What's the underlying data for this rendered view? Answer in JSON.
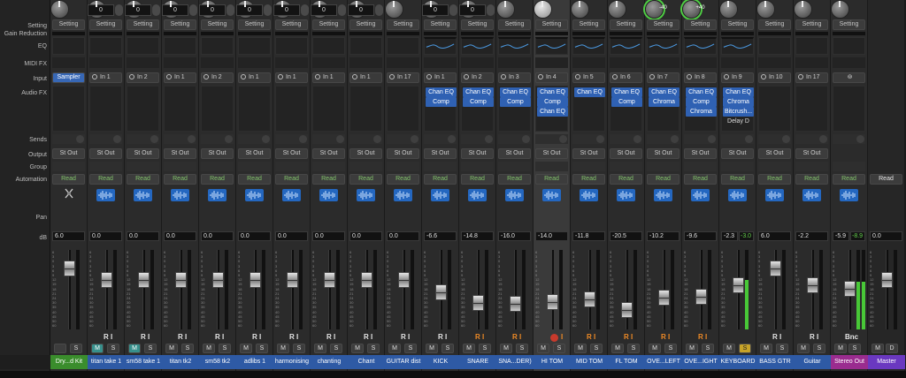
{
  "row_labels": [
    "Setting",
    "Gain Reduction",
    "EQ",
    "MIDI FX",
    "Input",
    "Audio FX",
    "Sends",
    "Output",
    "Group",
    "Automation",
    "Pan",
    "dB"
  ],
  "colors": {
    "drum": "#3a8d2c",
    "blue": "#2e5aa5",
    "pink": "#9a2c8f",
    "purple": "#6a38c0",
    "meter_green": "#48c837",
    "fx_blue": "#2f61b3"
  },
  "strips": [
    {
      "name": "Dry...d Kit",
      "color": "#3a8d2c",
      "input": "Sampler",
      "input_kind": "instrument",
      "output": "St Out",
      "automation": "Read",
      "db": "6.0",
      "fader": 0.85,
      "fx": [],
      "mute": false,
      "solo": false,
      "ri": "",
      "setting": "Setting",
      "icon": "drummer-icon"
    },
    {
      "name": "titan take 1",
      "color": "#2e5aa5",
      "digit": "0",
      "input": "In 1",
      "output": "St Out",
      "automation": "Read",
      "db": "0.0",
      "fader": 0.68,
      "fx": [],
      "mute": true,
      "solo": false,
      "ri": "R I",
      "setting": "Setting"
    },
    {
      "name": "sm58 take 1",
      "color": "#2e5aa5",
      "digit": "0",
      "input": "In 2",
      "output": "St Out",
      "automation": "Read",
      "db": "0.0",
      "fader": 0.68,
      "fx": [],
      "mute": true,
      "solo": false,
      "ri": "R I",
      "setting": "Setting"
    },
    {
      "name": "titan tk2",
      "color": "#2e5aa5",
      "digit": "0",
      "input": "In 1",
      "output": "St Out",
      "automation": "Read",
      "db": "0.0",
      "fader": 0.68,
      "fx": [],
      "mute": false,
      "solo": false,
      "ri": "R I",
      "setting": "Setting"
    },
    {
      "name": "sm58 tk2",
      "color": "#2e5aa5",
      "digit": "0",
      "input": "In 2",
      "output": "St Out",
      "automation": "Read",
      "db": "0.0",
      "fader": 0.68,
      "fx": [],
      "mute": false,
      "solo": false,
      "ri": "R I",
      "setting": "Setting"
    },
    {
      "name": "adlibs 1",
      "color": "#2e5aa5",
      "digit": "0",
      "input": "In 1",
      "output": "St Out",
      "automation": "Read",
      "db": "0.0",
      "fader": 0.68,
      "fx": [],
      "mute": false,
      "solo": false,
      "ri": "R I",
      "setting": "Setting"
    },
    {
      "name": "harmonising",
      "color": "#2e5aa5",
      "digit": "0",
      "input": "In 1",
      "output": "St Out",
      "automation": "Read",
      "db": "0.0",
      "fader": 0.68,
      "fx": [],
      "mute": false,
      "solo": false,
      "ri": "R I",
      "setting": "Setting"
    },
    {
      "name": "chanting",
      "color": "#2e5aa5",
      "digit": "0",
      "input": "In 1",
      "output": "St Out",
      "automation": "Read",
      "db": "0.0",
      "fader": 0.68,
      "fx": [],
      "mute": false,
      "solo": false,
      "ri": "R I",
      "setting": "Setting"
    },
    {
      "name": "Chant",
      "color": "#2e5aa5",
      "digit": "0",
      "input": "In 1",
      "output": "St Out",
      "automation": "Read",
      "db": "0.0",
      "fader": 0.68,
      "fx": [],
      "mute": false,
      "solo": false,
      "ri": "R I",
      "setting": "Setting"
    },
    {
      "name": "GUITAR dist",
      "color": "#2e5aa5",
      "input": "In 17",
      "output": "St Out",
      "automation": "Read",
      "db": "0.0",
      "fader": 0.68,
      "fx": [],
      "mute": false,
      "solo": false,
      "ri": "R I",
      "setting": "Setting"
    },
    {
      "name": "KICK",
      "color": "#2e5aa5",
      "digit": "0",
      "input": "In 1",
      "output": "St Out",
      "automation": "Read",
      "db": "-6.6",
      "fader": 0.5,
      "fx": [
        "Chan EQ",
        "Comp"
      ],
      "eq": true,
      "mute": false,
      "solo": false,
      "ri": "R I",
      "setting": "Setting"
    },
    {
      "name": "SNARE",
      "color": "#2e5aa5",
      "digit": "0",
      "input": "In 2",
      "output": "St Out",
      "automation": "Read",
      "db": "-14.8",
      "fader": 0.35,
      "fx": [
        "Chan EQ",
        "Comp"
      ],
      "eq": true,
      "mute": false,
      "solo": false,
      "ri": "R I",
      "ri_orange": true,
      "setting": "Setting"
    },
    {
      "name": "SNA...DER)",
      "color": "#2e5aa5",
      "input": "In 3",
      "output": "St Out",
      "automation": "Read",
      "db": "-16.0",
      "fader": 0.33,
      "fx": [
        "Chan EQ",
        "Comp"
      ],
      "eq": true,
      "mute": false,
      "solo": false,
      "ri": "R I",
      "ri_orange": true,
      "setting": "Setting"
    },
    {
      "name": "HI TOM",
      "color": "#2e5aa5",
      "input": "In 4",
      "output": "St Out",
      "automation": "Read",
      "db": "-14.0",
      "fader": 0.36,
      "fx": [
        "Chan EQ",
        "Comp",
        "Chan EQ"
      ],
      "eq": true,
      "mute": false,
      "solo": false,
      "ri": "I",
      "rec": true,
      "selected": true,
      "setting": "Setting"
    },
    {
      "name": "MID TOM",
      "color": "#2e5aa5",
      "input": "In 5",
      "output": "St Out",
      "automation": "Read",
      "db": "-11.8",
      "fader": 0.4,
      "fx": [
        "Chan EQ"
      ],
      "eq": true,
      "mute": false,
      "solo": false,
      "ri": "R I",
      "ri_orange": true,
      "setting": "Setting"
    },
    {
      "name": "FL TOM",
      "color": "#2e5aa5",
      "input": "In 6",
      "output": "St Out",
      "automation": "Read",
      "db": "-20.5",
      "fader": 0.25,
      "fx": [
        "Chan EQ",
        "Comp"
      ],
      "eq": true,
      "mute": false,
      "solo": false,
      "ri": "R I",
      "ri_orange": true,
      "setting": "Setting"
    },
    {
      "name": "OVE...LEFT",
      "color": "#2e5aa5",
      "input": "In 7",
      "output": "St Out",
      "automation": "Read",
      "db": "-10.2",
      "fader": 0.42,
      "fx": [
        "Chan EQ",
        "Chroma"
      ],
      "eq": true,
      "pan_value": "-40",
      "mute": false,
      "solo": false,
      "ri": "R I",
      "ri_orange": true,
      "setting": "Setting"
    },
    {
      "name": "OVE...IGHT",
      "color": "#2e5aa5",
      "input": "In 8",
      "output": "St Out",
      "automation": "Read",
      "db": "-9.6",
      "fader": 0.43,
      "fx": [
        "Chan EQ",
        "Comp",
        "Chroma"
      ],
      "eq": true,
      "pan_value": "+40",
      "mute": false,
      "solo": false,
      "ri": "R I",
      "ri_orange": true,
      "setting": "Setting"
    },
    {
      "name": "KEYBOARD",
      "color": "#2e5aa5",
      "input": "In 9",
      "output": "St Out",
      "automation": "Read",
      "db": "-2.3",
      "db2": "-3.0",
      "fader": 0.6,
      "fx": [
        "Chan EQ",
        "Chroma",
        "Bitcrush..."
      ],
      "fx_extra": "Delay D",
      "eq": true,
      "mute": false,
      "solo": true,
      "ri": "",
      "meter": 0.62,
      "setting": "Setting"
    },
    {
      "name": "BASS GTR",
      "color": "#2e5aa5",
      "input": "In 10",
      "output": "St Out",
      "automation": "Read",
      "db": "6.0",
      "fader": 0.85,
      "fx": [],
      "mute": false,
      "solo": false,
      "ri": "R I",
      "setting": "Setting"
    },
    {
      "name": "Guitar",
      "color": "#2e5aa5",
      "input": "In 17",
      "output": "St Out",
      "automation": "Read",
      "db": "-2.2",
      "fader": 0.6,
      "fx": [],
      "mute": false,
      "solo": false,
      "ri": "R I",
      "setting": "Setting"
    },
    {
      "name": "Stereo Out",
      "color": "#9a2c8f",
      "input": "",
      "input_kind": "stereo",
      "output": "",
      "automation": "Read",
      "db": "-5.9",
      "db2": "-8.9",
      "fader": 0.55,
      "fx": [],
      "mute": false,
      "solo": false,
      "ri": "Bnc",
      "meter": 0.6,
      "stereo": true,
      "setting": "Setting"
    },
    {
      "name": "Master",
      "color": "#6a38c0",
      "input": "",
      "input_kind": "none",
      "output": "",
      "automation": "Read",
      "automation_white": true,
      "db": "0.0",
      "fader": 0.68,
      "fx": [],
      "mute": false,
      "solo": false,
      "ri": "",
      "master": true,
      "setting": ""
    }
  ]
}
